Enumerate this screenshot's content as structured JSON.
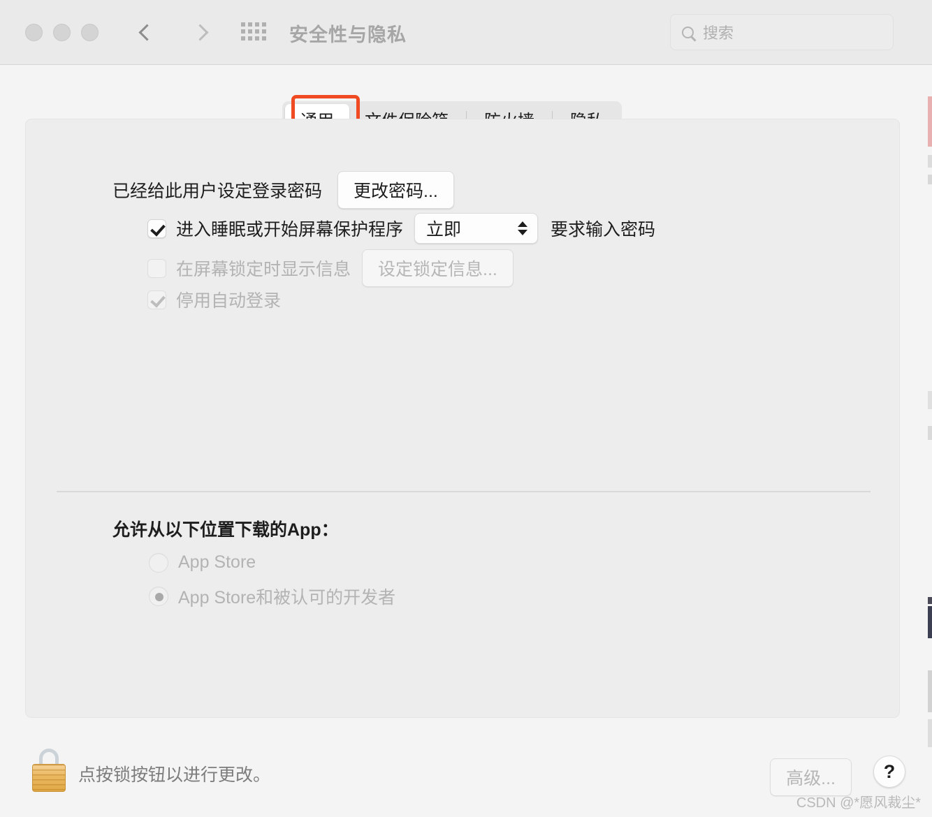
{
  "titlebar": {
    "title": "安全性与隐私",
    "back_icon": "chevron-left-icon",
    "forward_icon": "chevron-right-icon",
    "grid_icon": "grid-apps-icon",
    "search": {
      "placeholder": "搜索",
      "value": "",
      "icon": "search-icon"
    }
  },
  "tabs": [
    {
      "label": "通用",
      "selected": true
    },
    {
      "label": "文件保险箱",
      "selected": false
    },
    {
      "label": "防火墙",
      "selected": false
    },
    {
      "label": "隐私",
      "selected": false
    }
  ],
  "annotation": {
    "color": "#f04a22",
    "target": "通用"
  },
  "general": {
    "password_status": "已经给此用户设定登录密码",
    "change_password_button": "更改密码...",
    "require_password": {
      "checkbox_checked": true,
      "label_before": "进入睡眠或开始屏幕保护程序",
      "delay_value": "立即",
      "label_after": "要求输入密码"
    },
    "lock_message": {
      "checkbox_checked": false,
      "disabled": true,
      "label": "在屏幕锁定时显示信息",
      "button": "设定锁定信息..."
    },
    "disable_auto_login": {
      "checkbox_checked": true,
      "disabled": true,
      "label": "停用自动登录"
    }
  },
  "download_section": {
    "heading": "允许从以下位置下载的App：",
    "options": [
      {
        "label": "App Store",
        "selected": false
      },
      {
        "label": "App Store和被认可的开发者",
        "selected": true
      }
    ]
  },
  "footer": {
    "lock_icon": "lock-closed-icon",
    "message": "点按锁按钮以进行更改。",
    "advanced_button": "高级...",
    "help_button": "?"
  },
  "watermark": "CSDN @*愿风裁尘*"
}
